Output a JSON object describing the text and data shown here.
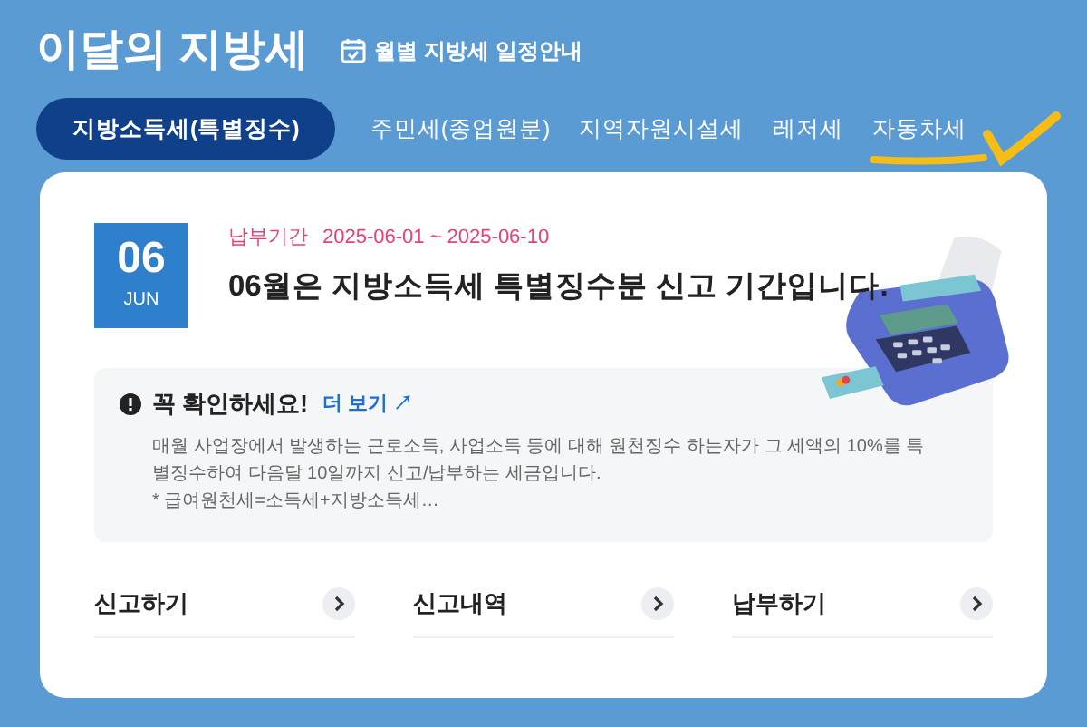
{
  "header": {
    "title": "이달의 지방세",
    "schedule_link": "월별 지방세 일정안내"
  },
  "tabs": [
    {
      "label": "지방소득세(특별징수)",
      "selected": true
    },
    {
      "label": "주민세(종업원분)",
      "selected": false
    },
    {
      "label": "지역자원시설세",
      "selected": false
    },
    {
      "label": "레저세",
      "selected": false
    },
    {
      "label": "자동차세",
      "selected": false
    }
  ],
  "card": {
    "date": {
      "day": "06",
      "month": "JUN"
    },
    "period_label": "납부기간",
    "period": "2025-06-01 ~ 2025-06-10",
    "headline": "06월은 지방소득세 특별징수분 신고 기간입니다.",
    "notice": {
      "title": "꼭 확인하세요!",
      "more_link": "더 보기",
      "more_icon": "↗",
      "body": "매월 사업장에서 발생하는 근로소득, 사업소득 등에 대해 원천징수 하는자가 그 세액의 10%를 특별징수하여 다음달 10일까지 신고/납부하는 세금입니다.",
      "note": "* 급여원천세=소득세+지방소득세…"
    },
    "links": [
      {
        "label": "신고하기"
      },
      {
        "label": "신고내역"
      },
      {
        "label": "납부하기"
      }
    ]
  }
}
